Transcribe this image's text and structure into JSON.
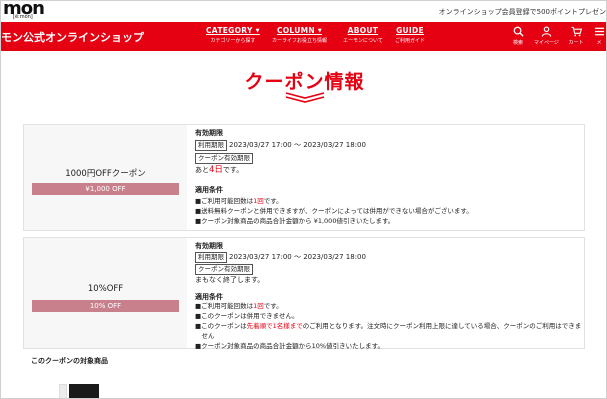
{
  "topbar": {
    "logo_text": "mon",
    "logo_sub": "[ë:mon]",
    "notice": "オンラインショップ会員登録で500ポイントプレゼン"
  },
  "navbar": {
    "site_title": "モン公式オンラインショップ",
    "items": [
      {
        "label": "CATEGORY",
        "sub": "カテゴリーから探す",
        "has_caret": true
      },
      {
        "label": "COLUMN",
        "sub": "カーライフお役立ち情報",
        "has_caret": true
      },
      {
        "label": "ABOUT",
        "sub": "エーモンについて",
        "has_caret": false
      },
      {
        "label": "GUIDE",
        "sub": "ご利用ガイド",
        "has_caret": false
      }
    ],
    "icons": [
      {
        "name": "search-icon",
        "label": "検索"
      },
      {
        "name": "user-icon",
        "label": "マイページ"
      },
      {
        "name": "cart-icon",
        "label": "カート"
      },
      {
        "name": "menu-icon",
        "label": "メ"
      }
    ]
  },
  "page": {
    "title": "クーポン情報"
  },
  "coupons": [
    {
      "name": "1000円OFFクーポン",
      "discount": "¥1,000 OFF",
      "validity_heading": "有効期限",
      "period_tag": "利用期限",
      "period": "2023/03/27 17:00 ～ 2023/03/27 18:00",
      "validity_tag": "クーポン有効期限",
      "remaining_prefix": "あと",
      "remaining_value": "4日",
      "remaining_suffix": "です。",
      "conditions_heading": "適用条件",
      "conditions": [
        {
          "pre": "■ご利用可能回数は",
          "hl": "1回",
          "post": "です。"
        },
        {
          "pre": "■送料無料クーポンと併用できますが、クーポンによっては併用ができない場合がございます。",
          "hl": "",
          "post": ""
        },
        {
          "pre": "■クーポン対象商品の商品合計金額から ¥1,000値引きいたします。",
          "hl": "",
          "post": ""
        }
      ]
    },
    {
      "name": "10%OFF",
      "discount": "10% OFF",
      "validity_heading": "有効期限",
      "period_tag": "利用期限",
      "period": "2023/03/27 17:00 ～ 2023/03/27 18:00",
      "validity_tag": "クーポン有効期限",
      "remaining_text": "まもなく終了します。",
      "conditions_heading": "適用条件",
      "conditions": [
        {
          "pre": "■ご利用可能回数は",
          "hl": "1回",
          "post": "です。"
        },
        {
          "pre": "■このクーポンは併用できません。",
          "hl": "",
          "post": ""
        },
        {
          "pre": "■このクーポンは",
          "hl": "先着順で1名様まで",
          "post": "のご利用となります。注文時にクーポン利用上限に達している場合、クーポンのご利用はできま"
        },
        {
          "pre": "　せん",
          "hl": "",
          "post": ""
        },
        {
          "pre": "■クーポン対象商品の商品合計金額から10%値引きいたします。",
          "hl": "",
          "post": ""
        }
      ]
    }
  ],
  "products": {
    "heading": "このクーポンの対象商品"
  },
  "colors": {
    "brand_red": "#e50012",
    "discount_pink": "#c9808d",
    "card_bg": "#f7f7f7"
  }
}
